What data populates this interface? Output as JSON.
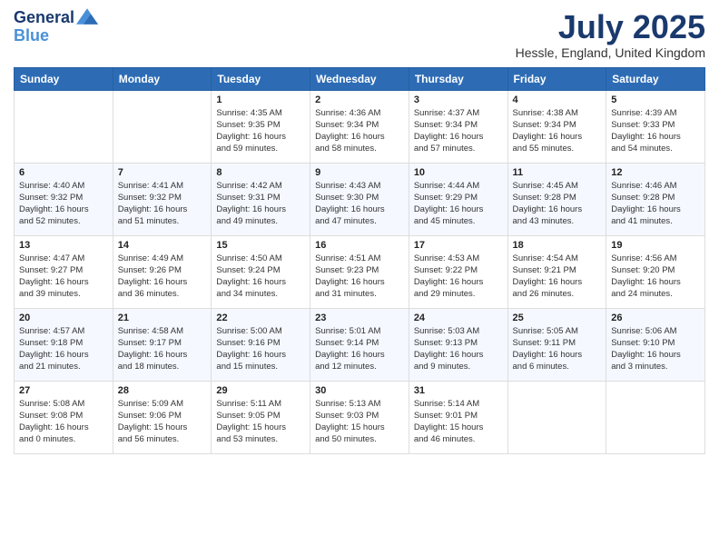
{
  "logo": {
    "line1": "General",
    "line2": "Blue"
  },
  "title": "July 2025",
  "location": "Hessle, England, United Kingdom",
  "days_of_week": [
    "Sunday",
    "Monday",
    "Tuesday",
    "Wednesday",
    "Thursday",
    "Friday",
    "Saturday"
  ],
  "weeks": [
    [
      {
        "day": "",
        "info": ""
      },
      {
        "day": "",
        "info": ""
      },
      {
        "day": "1",
        "info": "Sunrise: 4:35 AM\nSunset: 9:35 PM\nDaylight: 16 hours\nand 59 minutes."
      },
      {
        "day": "2",
        "info": "Sunrise: 4:36 AM\nSunset: 9:34 PM\nDaylight: 16 hours\nand 58 minutes."
      },
      {
        "day": "3",
        "info": "Sunrise: 4:37 AM\nSunset: 9:34 PM\nDaylight: 16 hours\nand 57 minutes."
      },
      {
        "day": "4",
        "info": "Sunrise: 4:38 AM\nSunset: 9:34 PM\nDaylight: 16 hours\nand 55 minutes."
      },
      {
        "day": "5",
        "info": "Sunrise: 4:39 AM\nSunset: 9:33 PM\nDaylight: 16 hours\nand 54 minutes."
      }
    ],
    [
      {
        "day": "6",
        "info": "Sunrise: 4:40 AM\nSunset: 9:32 PM\nDaylight: 16 hours\nand 52 minutes."
      },
      {
        "day": "7",
        "info": "Sunrise: 4:41 AM\nSunset: 9:32 PM\nDaylight: 16 hours\nand 51 minutes."
      },
      {
        "day": "8",
        "info": "Sunrise: 4:42 AM\nSunset: 9:31 PM\nDaylight: 16 hours\nand 49 minutes."
      },
      {
        "day": "9",
        "info": "Sunrise: 4:43 AM\nSunset: 9:30 PM\nDaylight: 16 hours\nand 47 minutes."
      },
      {
        "day": "10",
        "info": "Sunrise: 4:44 AM\nSunset: 9:29 PM\nDaylight: 16 hours\nand 45 minutes."
      },
      {
        "day": "11",
        "info": "Sunrise: 4:45 AM\nSunset: 9:28 PM\nDaylight: 16 hours\nand 43 minutes."
      },
      {
        "day": "12",
        "info": "Sunrise: 4:46 AM\nSunset: 9:28 PM\nDaylight: 16 hours\nand 41 minutes."
      }
    ],
    [
      {
        "day": "13",
        "info": "Sunrise: 4:47 AM\nSunset: 9:27 PM\nDaylight: 16 hours\nand 39 minutes."
      },
      {
        "day": "14",
        "info": "Sunrise: 4:49 AM\nSunset: 9:26 PM\nDaylight: 16 hours\nand 36 minutes."
      },
      {
        "day": "15",
        "info": "Sunrise: 4:50 AM\nSunset: 9:24 PM\nDaylight: 16 hours\nand 34 minutes."
      },
      {
        "day": "16",
        "info": "Sunrise: 4:51 AM\nSunset: 9:23 PM\nDaylight: 16 hours\nand 31 minutes."
      },
      {
        "day": "17",
        "info": "Sunrise: 4:53 AM\nSunset: 9:22 PM\nDaylight: 16 hours\nand 29 minutes."
      },
      {
        "day": "18",
        "info": "Sunrise: 4:54 AM\nSunset: 9:21 PM\nDaylight: 16 hours\nand 26 minutes."
      },
      {
        "day": "19",
        "info": "Sunrise: 4:56 AM\nSunset: 9:20 PM\nDaylight: 16 hours\nand 24 minutes."
      }
    ],
    [
      {
        "day": "20",
        "info": "Sunrise: 4:57 AM\nSunset: 9:18 PM\nDaylight: 16 hours\nand 21 minutes."
      },
      {
        "day": "21",
        "info": "Sunrise: 4:58 AM\nSunset: 9:17 PM\nDaylight: 16 hours\nand 18 minutes."
      },
      {
        "day": "22",
        "info": "Sunrise: 5:00 AM\nSunset: 9:16 PM\nDaylight: 16 hours\nand 15 minutes."
      },
      {
        "day": "23",
        "info": "Sunrise: 5:01 AM\nSunset: 9:14 PM\nDaylight: 16 hours\nand 12 minutes."
      },
      {
        "day": "24",
        "info": "Sunrise: 5:03 AM\nSunset: 9:13 PM\nDaylight: 16 hours\nand 9 minutes."
      },
      {
        "day": "25",
        "info": "Sunrise: 5:05 AM\nSunset: 9:11 PM\nDaylight: 16 hours\nand 6 minutes."
      },
      {
        "day": "26",
        "info": "Sunrise: 5:06 AM\nSunset: 9:10 PM\nDaylight: 16 hours\nand 3 minutes."
      }
    ],
    [
      {
        "day": "27",
        "info": "Sunrise: 5:08 AM\nSunset: 9:08 PM\nDaylight: 16 hours\nand 0 minutes."
      },
      {
        "day": "28",
        "info": "Sunrise: 5:09 AM\nSunset: 9:06 PM\nDaylight: 15 hours\nand 56 minutes."
      },
      {
        "day": "29",
        "info": "Sunrise: 5:11 AM\nSunset: 9:05 PM\nDaylight: 15 hours\nand 53 minutes."
      },
      {
        "day": "30",
        "info": "Sunrise: 5:13 AM\nSunset: 9:03 PM\nDaylight: 15 hours\nand 50 minutes."
      },
      {
        "day": "31",
        "info": "Sunrise: 5:14 AM\nSunset: 9:01 PM\nDaylight: 15 hours\nand 46 minutes."
      },
      {
        "day": "",
        "info": ""
      },
      {
        "day": "",
        "info": ""
      }
    ]
  ]
}
